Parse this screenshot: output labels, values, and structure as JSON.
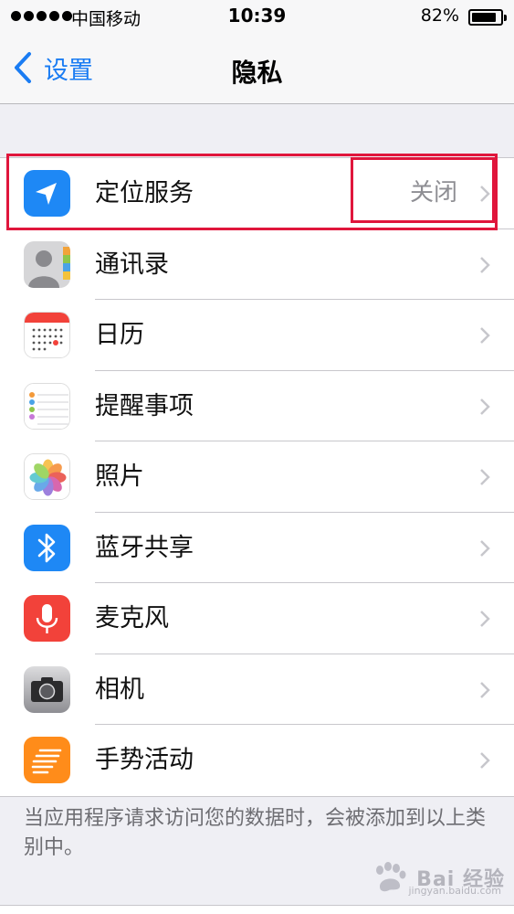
{
  "status_bar": {
    "carrier": "中国移动",
    "time": "10:39",
    "battery_percent": "82%",
    "battery_level": 0.82,
    "signal_bars": 5
  },
  "nav": {
    "back_label": "设置",
    "title": "隐私"
  },
  "list": [
    {
      "label": "定位服务",
      "value": "关闭",
      "icon": "location-arrow-icon",
      "icon_color": "#1e88f5"
    },
    {
      "label": "通讯录",
      "value": "",
      "icon": "contacts-icon",
      "icon_color": "#9e9e9e"
    },
    {
      "label": "日历",
      "value": "",
      "icon": "calendar-icon",
      "icon_color": "#ffffff"
    },
    {
      "label": "提醒事项",
      "value": "",
      "icon": "reminders-icon",
      "icon_color": "#ffffff"
    },
    {
      "label": "照片",
      "value": "",
      "icon": "photos-icon",
      "icon_color": "#ffffff"
    },
    {
      "label": "蓝牙共享",
      "value": "",
      "icon": "bluetooth-icon",
      "icon_color": "#1e88f5"
    },
    {
      "label": "麦克风",
      "value": "",
      "icon": "microphone-icon",
      "icon_color": "#f2423a"
    },
    {
      "label": "相机",
      "value": "",
      "icon": "camera-icon",
      "icon_color": "#8e8e93"
    },
    {
      "label": "手势活动",
      "value": "",
      "icon": "motion-activity-icon",
      "icon_color": "#ff8c1a"
    }
  ],
  "footer_note": "当应用程序请求访问您的数据时，会被添加到以上类别中。",
  "watermark": {
    "text": "Bai 经验",
    "site": "jingyan.baidu.com"
  },
  "colors": {
    "accent": "#1a7cf3",
    "highlight": "#e0163c",
    "background": "#efeff4"
  }
}
